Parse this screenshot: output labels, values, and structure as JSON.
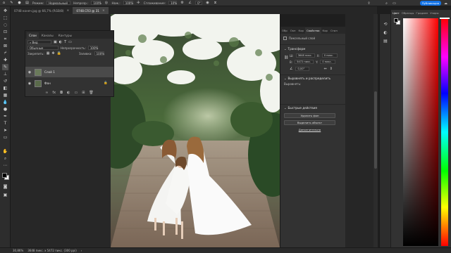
{
  "options_bar": {
    "mode_label": "Режим:",
    "mode_value": "Нормальный",
    "opacity_label": "Непрозр.:",
    "opacity_value": "100%",
    "pressure_opacity_value": "10%",
    "flow_label": "Наж.:",
    "flow_value": "100%",
    "smoothing_label": "Сглаживание:",
    "smoothing_value": "10%",
    "angle_value": "0°",
    "publish_label": "Публикация"
  },
  "tabs": [
    {
      "label": "0748 конеч.jpg @ 66,7% (RGB/8)",
      "active": false
    },
    {
      "label": "0748.CR3 @ 31",
      "active": true
    }
  ],
  "layers_panel": {
    "tabs": [
      "Слои",
      "Каналы",
      "Контуры"
    ],
    "filter_value": "Вид",
    "blend_mode": "Обычные",
    "opacity_label": "Непрозрачность:",
    "opacity_value": "100%",
    "lock_label": "Закрепить:",
    "fill_label": "Заливка:",
    "fill_value": "100%",
    "layers": [
      {
        "name": "Слой 1",
        "selected": true
      },
      {
        "name": "Фон",
        "selected": false
      }
    ]
  },
  "properties_panel": {
    "tabs": [
      "Обр",
      "Окн",
      "Кор",
      "Свойства",
      "Кор",
      "Стил"
    ],
    "active_tab": "Свойства",
    "layer_type": "Пиксельный слой",
    "transform_title": "Трансформ",
    "width_label": "Ш:",
    "width_value": "3648 пикс.",
    "x_label": "X:",
    "x_value": "0 пикс.",
    "height_label": "В:",
    "height_value": "5472 пикс.",
    "y_label": "Y:",
    "y_value": "0 пикс.",
    "angle_value": "0,00°",
    "align_title": "Выровнять и распределить",
    "align_label": "Выровнять:",
    "quick_actions_title": "Быстрые действия",
    "remove_bg_label": "Удалить фон",
    "select_subject_label": "Выделить объект",
    "more_label": "Дополнительно"
  },
  "color_panel": {
    "tabs": [
      "Цвет",
      "Образцы",
      "Градиен",
      "Узоры"
    ],
    "foreground": "#000000",
    "background": "#ffffff"
  },
  "status_bar": {
    "zoom": "30,86%",
    "doc_size": "3648 пикс. x 5472 пикс. (300 ppi)"
  },
  "colors": {
    "accent": "#1473e6",
    "panel_bg": "#323232",
    "canvas_bg": "#272727"
  }
}
